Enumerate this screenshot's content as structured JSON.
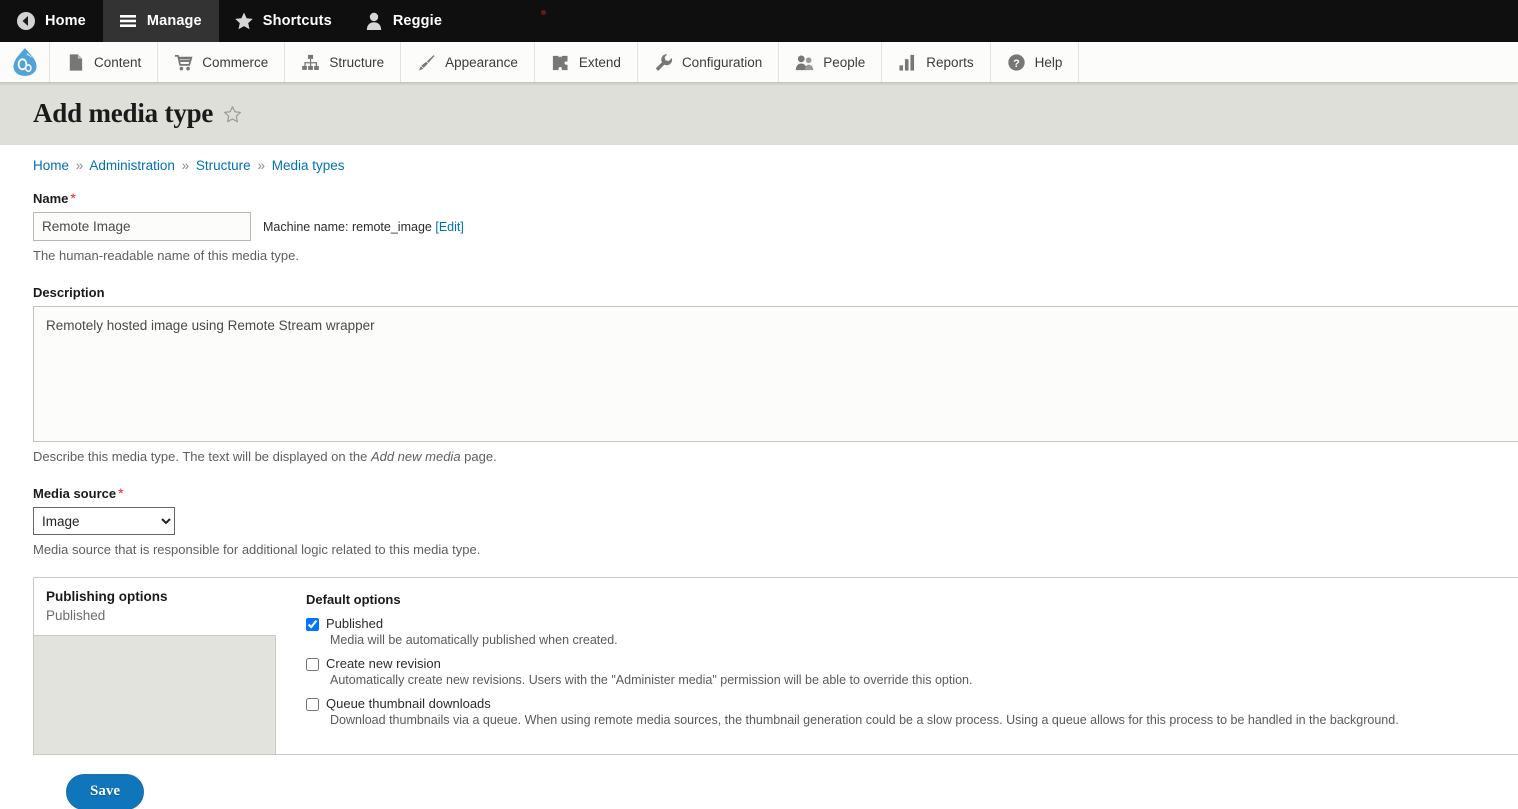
{
  "toolbar": {
    "tabs": [
      {
        "label": "Home",
        "icon": "back-arrow-icon",
        "active": false
      },
      {
        "label": "Manage",
        "icon": "hamburger-icon",
        "active": true
      },
      {
        "label": "Shortcuts",
        "icon": "star-icon",
        "active": false
      },
      {
        "label": "Reggie",
        "icon": "user-icon",
        "active": false
      }
    ]
  },
  "admin_menu": {
    "logo_label": "Drupal",
    "items": [
      {
        "label": "Content",
        "icon": "file-icon"
      },
      {
        "label": "Commerce",
        "icon": "shopping-cart-icon"
      },
      {
        "label": "Structure",
        "icon": "sitemap-icon"
      },
      {
        "label": "Appearance",
        "icon": "paintbrush-icon"
      },
      {
        "label": "Extend",
        "icon": "puzzle-piece-icon"
      },
      {
        "label": "Configuration",
        "icon": "wrench-icon"
      },
      {
        "label": "People",
        "icon": "people-icon"
      },
      {
        "label": "Reports",
        "icon": "bar-chart-icon"
      },
      {
        "label": "Help",
        "icon": "question-mark-icon"
      }
    ]
  },
  "page": {
    "title": "Add media type",
    "breadcrumb": [
      {
        "label": "Home"
      },
      {
        "label": "Administration"
      },
      {
        "label": "Structure"
      },
      {
        "label": "Media types"
      }
    ],
    "breadcrumb_separator": "»"
  },
  "form": {
    "name": {
      "label": "Name",
      "required_marker": "*",
      "value": "Remote Image",
      "placeholder": "",
      "machine_name_prefix": "Machine name:",
      "machine_name_value": "remote_image",
      "machine_name_edit": "[Edit]",
      "description": "The human-readable name of this media type."
    },
    "description": {
      "label": "Description",
      "value": "Remotely hosted image using Remote Stream wrapper",
      "placeholder": "",
      "help_before": "Describe this media type. The text will be displayed on the ",
      "help_em": "Add new media",
      "help_after": " page."
    },
    "media_source": {
      "label": "Media source",
      "required_marker": "*",
      "selected": "Image",
      "options": [
        "Image"
      ],
      "description": "Media source that is responsible for additional logic related to this media type."
    },
    "vertical_tabs": [
      {
        "title": "Publishing options",
        "summary": "Published",
        "selected": true
      }
    ],
    "default_options": {
      "heading": "Default options",
      "items": [
        {
          "label": "Published",
          "checked": true,
          "description": "Media will be automatically published when created."
        },
        {
          "label": "Create new revision",
          "checked": false,
          "description": "Automatically create new revisions. Users with the \"Administer media\" permission will be able to override this option."
        },
        {
          "label": "Queue thumbnail downloads",
          "checked": false,
          "description": "Download thumbnails via a queue. When using remote media sources, the thumbnail generation could be a slow process. Using a queue allows for this process to be handled in the background."
        }
      ]
    },
    "actions": {
      "save_label": "Save"
    }
  },
  "colors": {
    "toolbar_bg": "#0f0f0f",
    "toolbar_active": "#333333",
    "menu_bg": "#fcfcfa",
    "title_banner": "#dfdfd9",
    "link": "#0071b3",
    "primary_button": "#1076bc",
    "required": "#ee2222",
    "drupal_blue": "#4fa3d8"
  }
}
